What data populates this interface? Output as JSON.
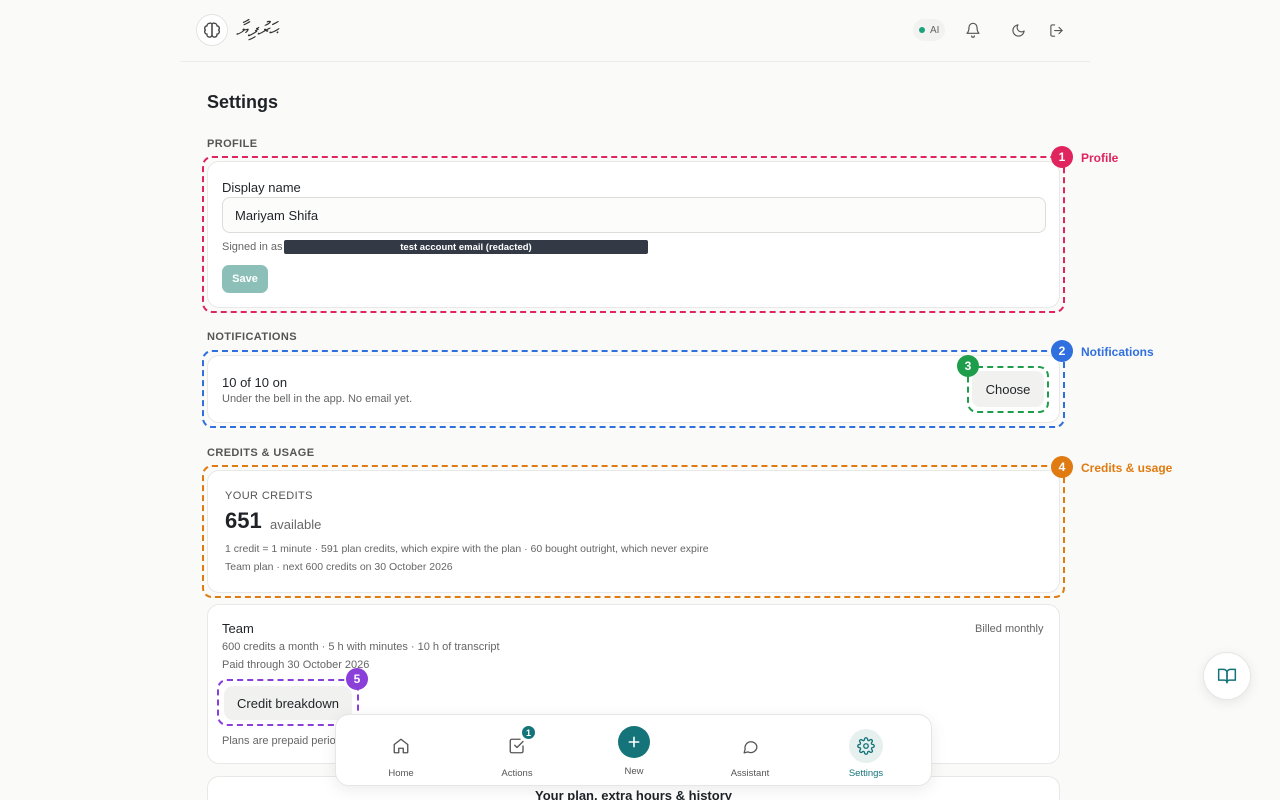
{
  "header": {
    "brand": "ޙަރުފިޔާ",
    "ai_label": "AI"
  },
  "page": {
    "title": "Settings"
  },
  "profile": {
    "section_label": "PROFILE",
    "annotation": "Profile",
    "annotation_num": "1",
    "field_label": "Display name",
    "name_value": "Mariyam Shifa",
    "signed_in_label": "Signed in as",
    "email_redacted": "test account email (redacted)",
    "save_label": "Save"
  },
  "notifications": {
    "section_label": "NOTIFICATIONS",
    "annotation": "Notifications",
    "annotation_num": "2",
    "choose_num": "3",
    "count_text": "10 of 10 on",
    "description": "Under the bell in the app. No email yet.",
    "choose_label": "Choose"
  },
  "credits": {
    "section_label": "CREDITS & USAGE",
    "annotation": "Credits & usage",
    "annotation_num": "4",
    "your_credits": "YOUR CREDITS",
    "amount": "651",
    "available": "available",
    "line1": "1 credit = 1 minute · 591 plan credits, which expire with the plan · 60 bought outright, which never expire",
    "line2": "Team plan · next 600 credits on 30 October 2026"
  },
  "team": {
    "name": "Team",
    "billing": "Billed monthly",
    "line1": "600 credits a month · 5 h with minutes · 10 h of transcript",
    "line2": "Paid through 30 October 2026",
    "breakdown_label": "Credit breakdown",
    "breakdown_num": "5",
    "footnote": "Plans are prepaid perio"
  },
  "plan_card": {
    "title": "Your plan, extra hours & history"
  },
  "nav": {
    "items": [
      {
        "label": "Home"
      },
      {
        "label": "Actions",
        "badge": "1"
      },
      {
        "label": "New"
      },
      {
        "label": "Assistant"
      },
      {
        "label": "Settings"
      }
    ]
  },
  "colors": {
    "accent": "#14747a",
    "profile": "#e0245e",
    "notifications": "#2f6fde",
    "choose": "#1e9e4a",
    "credits": "#e07b12",
    "breakdown": "#8b3fd9"
  }
}
